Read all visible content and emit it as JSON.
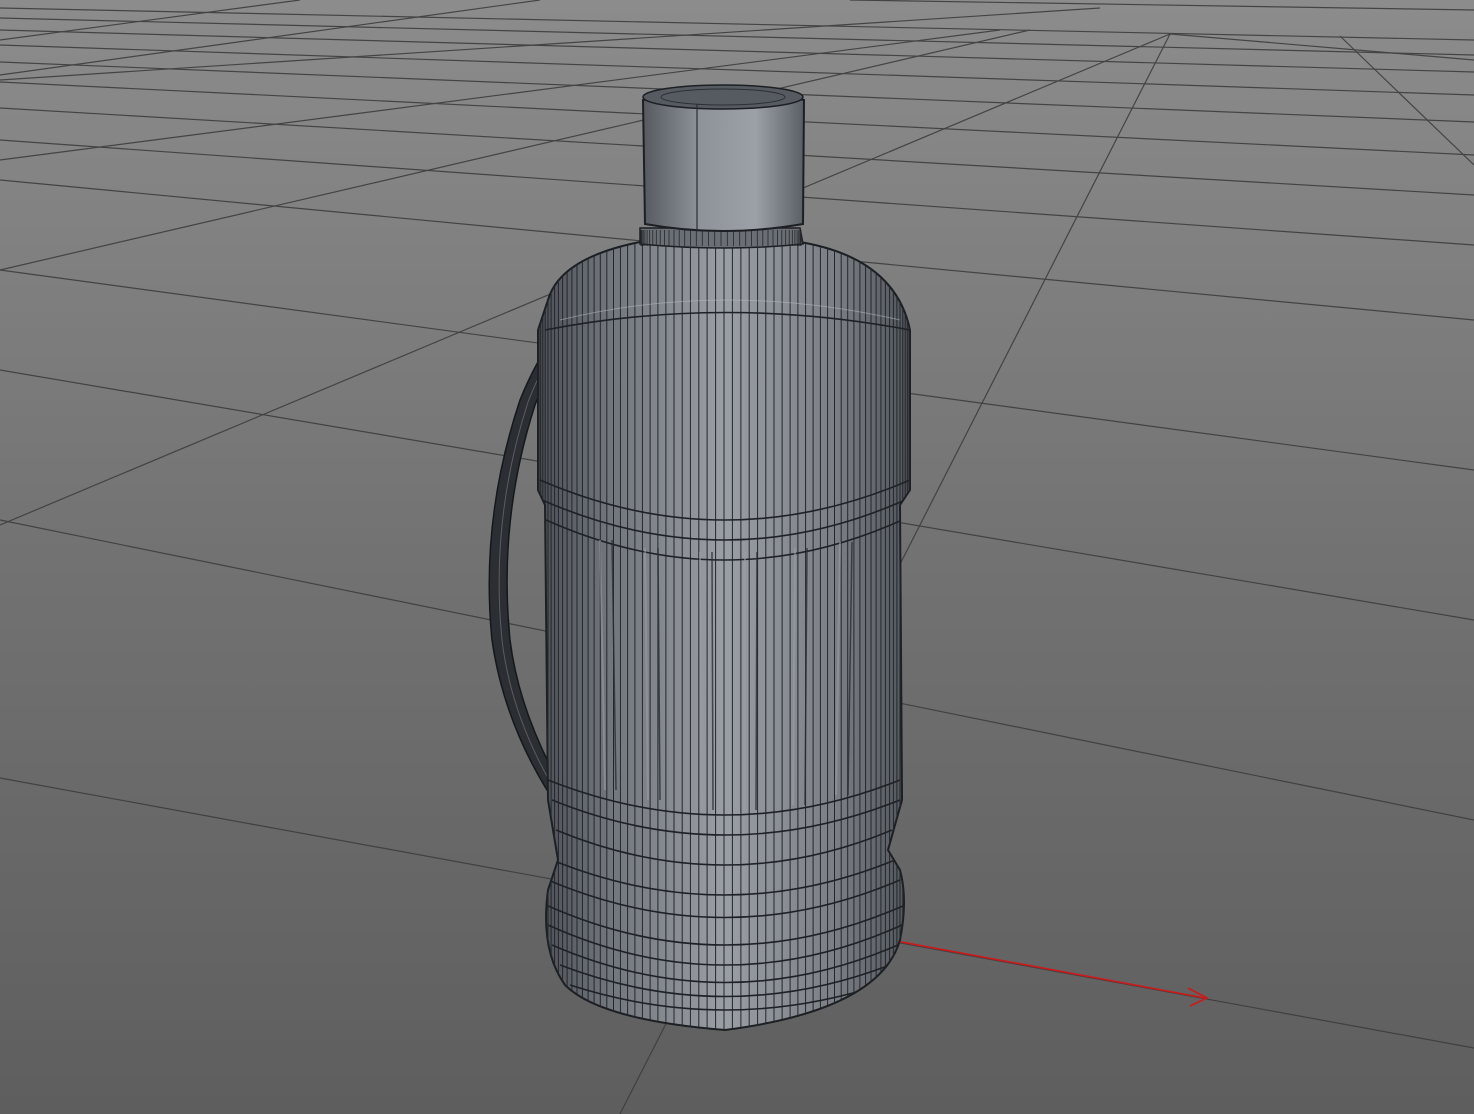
{
  "viewport": {
    "background_top": "#8a8a8a",
    "background_bottom": "#5f5f5f",
    "grid_color": "#3c3c3c",
    "x_axis_color": "#d01010"
  },
  "scene": {
    "object": "bottle",
    "object_color": "#7c8187",
    "wire_color": "#1e2226",
    "handle_color": "#2a2d31"
  }
}
